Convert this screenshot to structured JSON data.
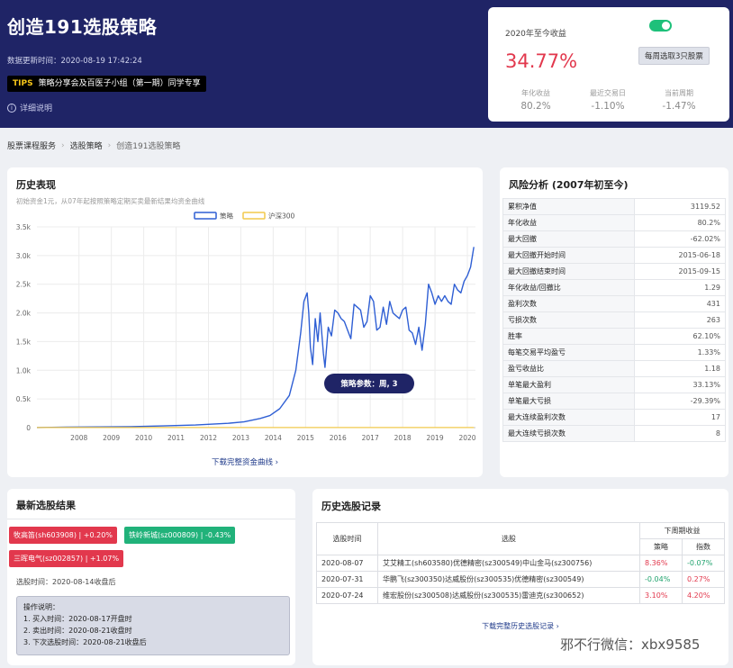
{
  "hero": {
    "title": "创造191选股策略",
    "updated": "数据更新时间：2020-08-19 17:42:24",
    "tips_tag": "TIPS",
    "tips_text": "策略分享会及百医子小组（第一期）同学专享",
    "detail_label": "详细说明"
  },
  "return_card": {
    "label": "2020年至今收益",
    "value": "34.77%",
    "button_label": "每周选取3只股票",
    "toggle_on": true,
    "stats": [
      {
        "label": "年化收益",
        "value": "80.2%"
      },
      {
        "label": "最近交易日",
        "value": "-1.10%"
      },
      {
        "label": "当前周期",
        "value": "-1.47%"
      }
    ]
  },
  "breadcrumb": [
    "股票课程服务",
    "选股策略",
    "创造191选股策略"
  ],
  "history": {
    "title": "历史表现",
    "subtitle": "初始资金1元，从07年起按照策略定期买卖最新结果均资金曲线",
    "download_label": "下载完整资金曲线",
    "badge": "策略参数：周, 3"
  },
  "chart_data": {
    "type": "line",
    "legend": [
      "策略",
      "沪深300"
    ],
    "legend_position": "top-center",
    "yticks": [
      "0",
      "0.5k",
      "1.0k",
      "1.5k",
      "2.0k",
      "2.5k",
      "3.0k",
      "3.5k"
    ],
    "ylim": [
      0,
      3500
    ],
    "xticks": [
      "2008",
      "2009",
      "2010",
      "2011",
      "2012",
      "2013",
      "2014",
      "2015",
      "2016",
      "2017",
      "2018",
      "2019",
      "2020"
    ],
    "xlim": [
      2007.1,
      2020.65
    ],
    "grid": true,
    "series": [
      {
        "name": "策略",
        "color": "#2f5fd4",
        "x": [
          2007.1,
          2008.0,
          2009.0,
          2010.0,
          2011.0,
          2012.0,
          2013.0,
          2013.5,
          2014.0,
          2014.3,
          2014.6,
          2014.9,
          2015.1,
          2015.25,
          2015.35,
          2015.45,
          2015.5,
          2015.55,
          2015.62,
          2015.7,
          2015.78,
          2015.85,
          2015.95,
          2016.0,
          2016.1,
          2016.2,
          2016.3,
          2016.4,
          2016.5,
          2016.6,
          2016.7,
          2016.8,
          2016.9,
          2017.0,
          2017.1,
          2017.2,
          2017.3,
          2017.4,
          2017.5,
          2017.6,
          2017.7,
          2017.8,
          2017.9,
          2018.0,
          2018.1,
          2018.2,
          2018.3,
          2018.4,
          2018.5,
          2018.6,
          2018.7,
          2018.8,
          2018.9,
          2019.0,
          2019.1,
          2019.2,
          2019.3,
          2019.4,
          2019.5,
          2019.6,
          2019.7,
          2019.8,
          2019.9,
          2020.0,
          2020.1,
          2020.2,
          2020.3,
          2020.4,
          2020.5,
          2020.6
        ],
        "y": [
          1,
          8,
          12,
          18,
          30,
          45,
          75,
          100,
          160,
          210,
          330,
          560,
          1000,
          1650,
          2200,
          2350,
          2000,
          1400,
          1100,
          1900,
          1500,
          2000,
          1300,
          1050,
          1750,
          1600,
          2050,
          2000,
          1900,
          1850,
          1700,
          1550,
          2150,
          2100,
          2050,
          1750,
          1850,
          2300,
          2200,
          1700,
          1750,
          2100,
          1800,
          2200,
          2000,
          1950,
          1900,
          2050,
          2100,
          1700,
          1650,
          1450,
          1750,
          1350,
          1800,
          2500,
          2350,
          2150,
          2300,
          2200,
          2300,
          2200,
          2150,
          2500,
          2400,
          2350,
          2550,
          2650,
          2800,
          3150
        ]
      },
      {
        "name": "沪深300",
        "color": "#f2c94c",
        "x": [
          2007.1,
          2020.6
        ],
        "y": [
          1,
          2
        ]
      }
    ]
  },
  "risk": {
    "title": "风险分析 (2007年初至今)",
    "rows": [
      {
        "label": "累积净值",
        "value": "3119.52"
      },
      {
        "label": "年化收益",
        "value": "80.2%"
      },
      {
        "label": "最大回撤",
        "value": "-62.02%"
      },
      {
        "label": "最大回撤开始时间",
        "value": "2015-06-18"
      },
      {
        "label": "最大回撤结束时间",
        "value": "2015-09-15"
      },
      {
        "label": "年化收益/回撤比",
        "value": "1.29"
      },
      {
        "label": "盈利次数",
        "value": "431"
      },
      {
        "label": "亏损次数",
        "value": "263"
      },
      {
        "label": "胜率",
        "value": "62.10%"
      },
      {
        "label": "每笔交易平均盈亏",
        "value": "1.33%"
      },
      {
        "label": "盈亏收益比",
        "value": "1.18"
      },
      {
        "label": "单笔最大盈利",
        "value": "33.13%"
      },
      {
        "label": "单笔最大亏损",
        "value": "-29.39%"
      },
      {
        "label": "最大连续盈利次数",
        "value": "17"
      },
      {
        "label": "最大连续亏损次数",
        "value": "8"
      }
    ]
  },
  "latest": {
    "title": "最新选股结果",
    "picks": [
      {
        "text": "牧高笛(sh603908) | +0.20%",
        "color": "#e2384d"
      },
      {
        "text": "铁岭新城(sz000809) | -0.43%",
        "color": "#21b27a"
      },
      {
        "text": "三晖电气(sz002857) | +1.07%",
        "color": "#e2384d"
      }
    ],
    "time": "选股时间：2020-08-14收盘后",
    "ops_title": "操作说明：",
    "ops": [
      "1. 买入时间：2020-08-17开盘时",
      "2. 卖出时间：2020-08-21收盘时",
      "3. 下次选股时间：2020-08-21收盘后"
    ]
  },
  "records": {
    "title": "历史选股记录",
    "headers": {
      "time": "选股时间",
      "stocks": "选股",
      "group": "下周期收益",
      "strategy": "策略",
      "index": "指数"
    },
    "rows": [
      {
        "time": "2020-08-07",
        "stocks": "艾艾精工(sh603580)优德精密(sz300549)中山金马(sz300756)",
        "strategy": "8.36%",
        "index": "-0.07%"
      },
      {
        "time": "2020-07-31",
        "stocks": "华鹏飞(sz300350)达威股份(sz300535)优德精密(sz300549)",
        "strategy": "-0.04%",
        "index": "0.27%"
      },
      {
        "time": "2020-07-24",
        "stocks": "维宏股份(sz300508)达威股份(sz300535)雷迪克(sz300652)",
        "strategy": "3.10%",
        "index": "4.20%"
      }
    ],
    "download_label": "下载完整历史选股记录"
  },
  "watermark": "邪不行微信：xbx9585"
}
